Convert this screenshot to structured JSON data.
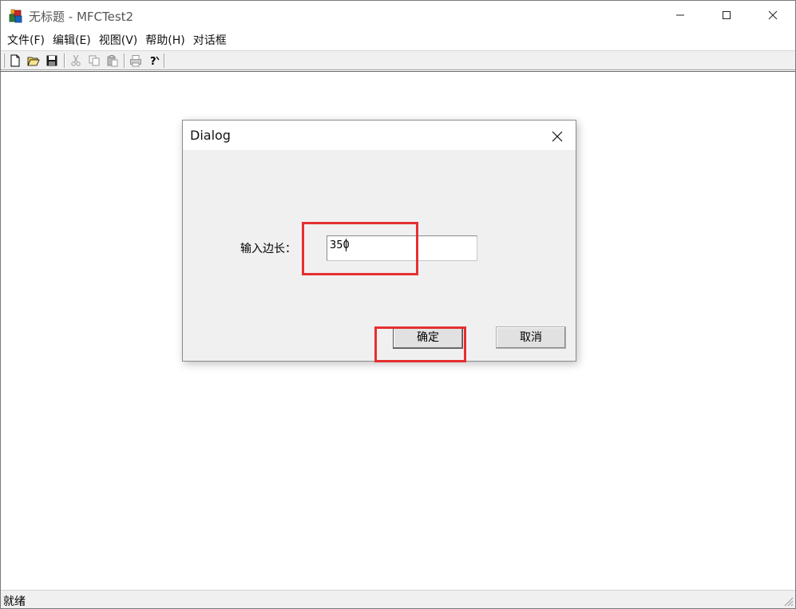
{
  "window": {
    "title": "无标题 - MFCTest2",
    "min_glyph": "—",
    "max_glyph": "☐",
    "close_glyph": "✕"
  },
  "menubar": {
    "items": [
      {
        "label": "文件(F)"
      },
      {
        "label": "编辑(E)"
      },
      {
        "label": "视图(V)"
      },
      {
        "label": "帮助(H)"
      },
      {
        "label": "对话框"
      }
    ]
  },
  "toolbar": {
    "buttons": [
      {
        "icon": "new-file-icon"
      },
      {
        "icon": "open-folder-icon"
      },
      {
        "icon": "save-disk-icon"
      },
      {
        "icon": "cut-scissors-icon"
      },
      {
        "icon": "copy-icon"
      },
      {
        "icon": "paste-icon"
      },
      {
        "icon": "print-icon"
      },
      {
        "icon": "help-context-icon"
      }
    ]
  },
  "statusbar": {
    "text": "就绪"
  },
  "dialog": {
    "title": "Dialog",
    "close_glyph": "✕",
    "label": "输入边长：",
    "input_value": "350",
    "ok_label": "确定",
    "cancel_label": "取消"
  },
  "colors": {
    "highlight": "#e53030",
    "dialog_bg": "#f0f0f0",
    "button_bg": "#e1e1e1"
  }
}
